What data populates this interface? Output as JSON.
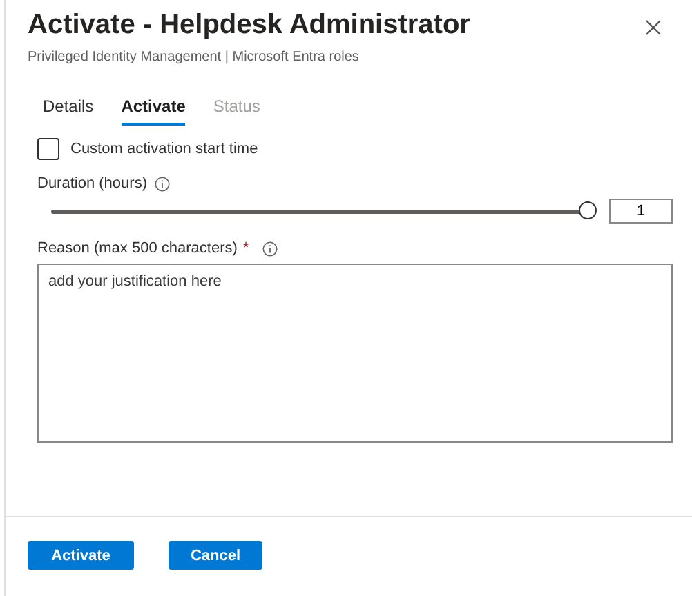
{
  "panel": {
    "title": "Activate - Helpdesk Administrator",
    "subtitle": "Privileged Identity Management | Microsoft Entra roles"
  },
  "tabs": [
    {
      "label": "Details",
      "selected": false,
      "disabled": false
    },
    {
      "label": "Activate",
      "selected": true,
      "disabled": false
    },
    {
      "label": "Status",
      "selected": false,
      "disabled": true
    }
  ],
  "custom_start": {
    "label": "Custom activation start time",
    "checked": false
  },
  "duration": {
    "label": "Duration (hours)",
    "level": 1,
    "value": "1"
  },
  "reason": {
    "label": "Reason (max 500 characters)",
    "required_mark": "*",
    "placeholder": "add your justification here"
  },
  "buttons": [
    {
      "label": "Activate"
    },
    {
      "label": "Cancel"
    }
  ]
}
